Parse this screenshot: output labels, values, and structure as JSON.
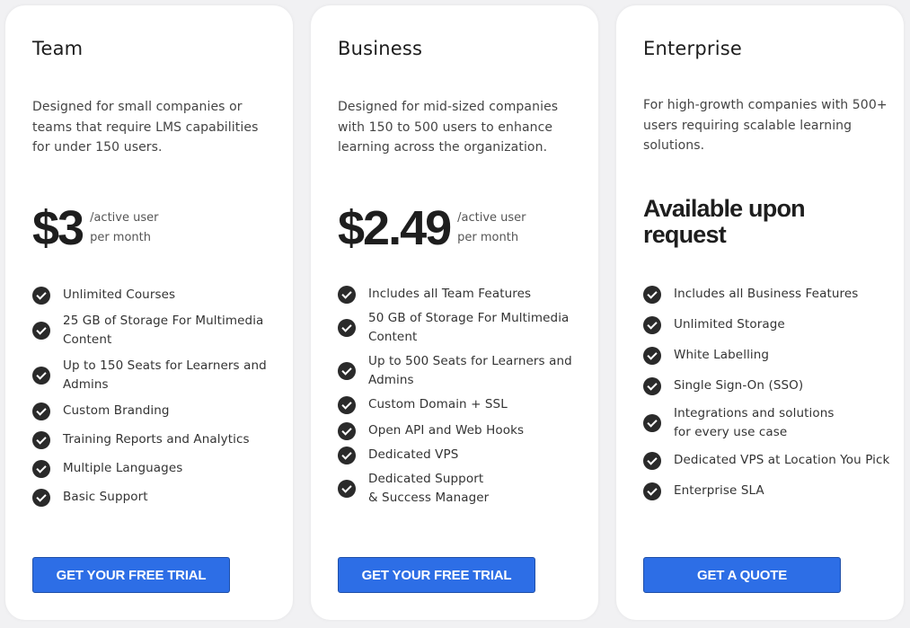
{
  "plans": [
    {
      "title": "Team",
      "description": "Designed for small companies or teams that require LMS capabilities for under 150 users.",
      "price": "$3",
      "price_unit_1": "/active user",
      "price_unit_2": "per month",
      "features": [
        "Unlimited Courses",
        "25 GB of Storage For Multimedia Content",
        "Up to 150 Seats for Learners and Admins",
        "Custom Branding",
        "Training Reports and Analytics",
        "Multiple Languages",
        "Basic Support"
      ],
      "cta": "GET YOUR FREE TRIAL"
    },
    {
      "title": "Business",
      "description": "Designed for mid-sized companies with 150 to 500 users to enhance learning across the organization.",
      "price": "$2.49",
      "price_unit_1": "/active user",
      "price_unit_2": "per month",
      "features": [
        "Includes all Team Features",
        "50 GB of Storage For Multimedia Content",
        "Up to 500 Seats for Learners and Admins",
        "Custom Domain + SSL",
        "Open API and Web Hooks",
        "Dedicated VPS",
        "Dedicated Support\n& Success Manager"
      ],
      "cta": "GET YOUR FREE TRIAL"
    },
    {
      "title": "Enterprise",
      "description": "For high-growth companies with 500+ users requiring scalable learning solutions.",
      "price_text": "Available upon request",
      "features": [
        "Includes all Business Features",
        "Unlimited Storage",
        "White Labelling",
        "Single Sign-On (SSO)",
        "Integrations and solutions\nfor every use case",
        "Dedicated VPS at Location You Pick",
        "Enterprise SLA"
      ],
      "cta": "GET A QUOTE"
    }
  ],
  "colors": {
    "accent": "#2d6ee6",
    "check": "#2a2a2a",
    "card": "#ffffff",
    "background": "#f1f1f3"
  },
  "icons": {
    "feature": "check-circle-icon"
  }
}
